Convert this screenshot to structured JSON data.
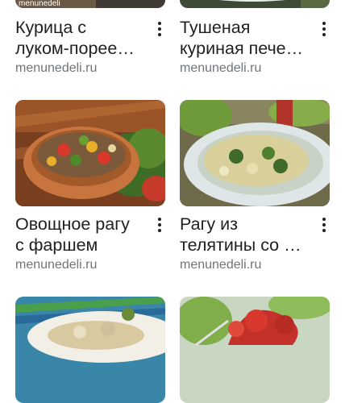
{
  "cards": [
    {
      "title_line1": "Курица с",
      "title_line2": "луком-порее…",
      "source": "menunedeli.ru",
      "thumb_icon": "chicken-dish-photo"
    },
    {
      "title_line1": "Тушеная",
      "title_line2": "куриная пече…",
      "source": "menunedeli.ru",
      "thumb_icon": "stewed-liver-photo"
    },
    {
      "title_line1": "Овощное рагу",
      "title_line2": "с фаршем",
      "source": "menunedeli.ru",
      "thumb_icon": "vegetable-stew-photo"
    },
    {
      "title_line1": "Рагу из",
      "title_line2": "телятины со …",
      "source": "menunedeli.ru",
      "thumb_icon": "veal-stew-photo"
    },
    {
      "title_line1": "",
      "title_line2": "",
      "source": "",
      "thumb_icon": "dumplings-photo"
    },
    {
      "title_line1": "",
      "title_line2": "",
      "source": "",
      "thumb_icon": "tomato-salad-photo"
    }
  ],
  "watermark_text": "menunedeli",
  "more_icon": "more-vert-icon"
}
